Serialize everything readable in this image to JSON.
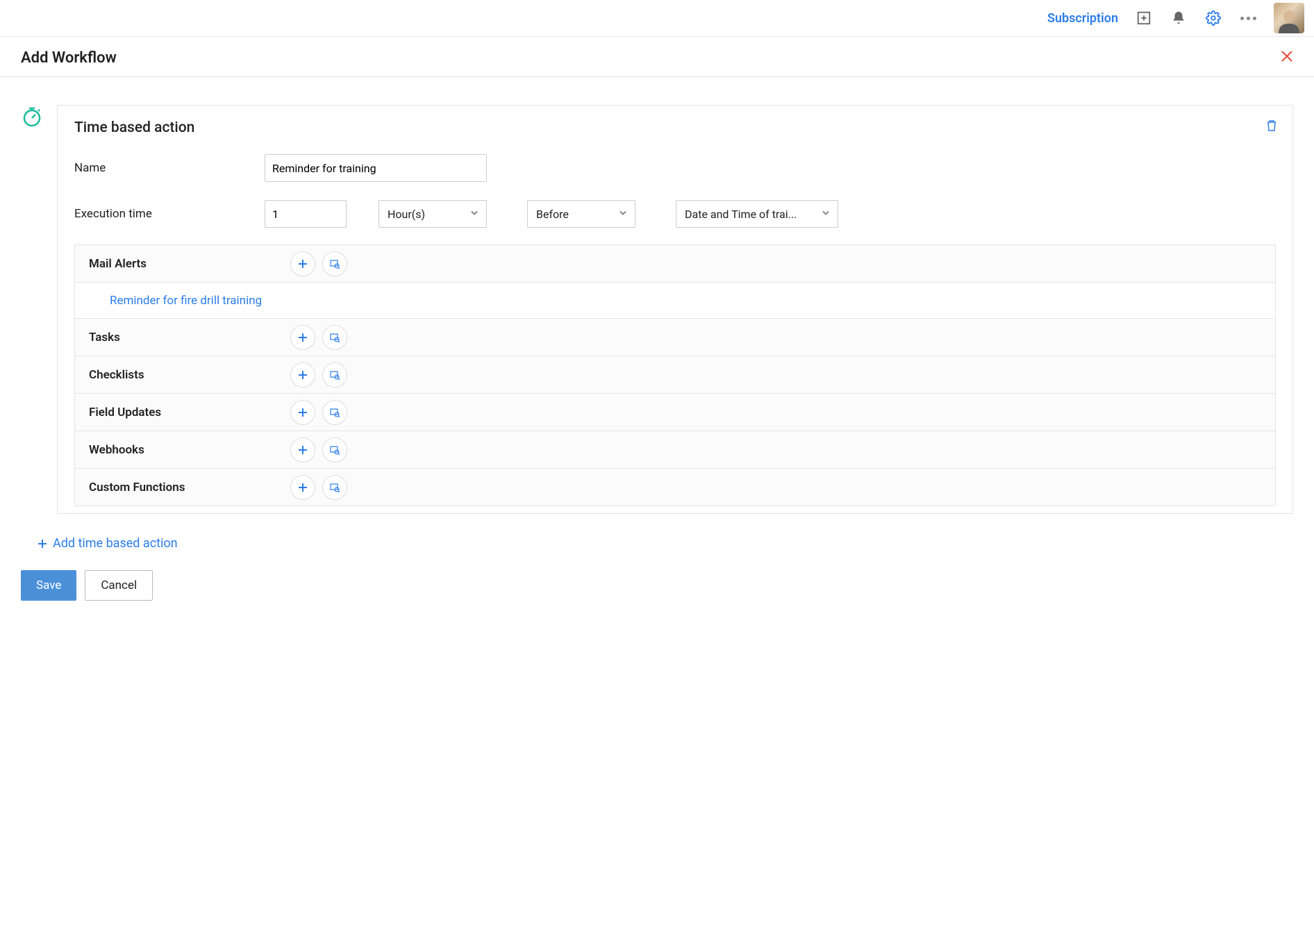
{
  "topbar": {
    "subscription_label": "Subscription"
  },
  "page": {
    "title": "Add Workflow"
  },
  "section": {
    "title": "Time based action",
    "name_label": "Name",
    "name_value": "Reminder for training",
    "exec_label": "Execution time",
    "exec_num": "1",
    "exec_unit": "Hour(s)",
    "exec_rel": "Before",
    "exec_field": "Date and Time of trai..."
  },
  "actions": {
    "mail_alerts": "Mail Alerts",
    "mail_alert_item": "Reminder for fire drill training",
    "tasks": "Tasks",
    "checklists": "Checklists",
    "field_updates": "Field Updates",
    "webhooks": "Webhooks",
    "custom_functions": "Custom Functions"
  },
  "add_link": "Add time based action",
  "buttons": {
    "save": "Save",
    "cancel": "Cancel"
  }
}
